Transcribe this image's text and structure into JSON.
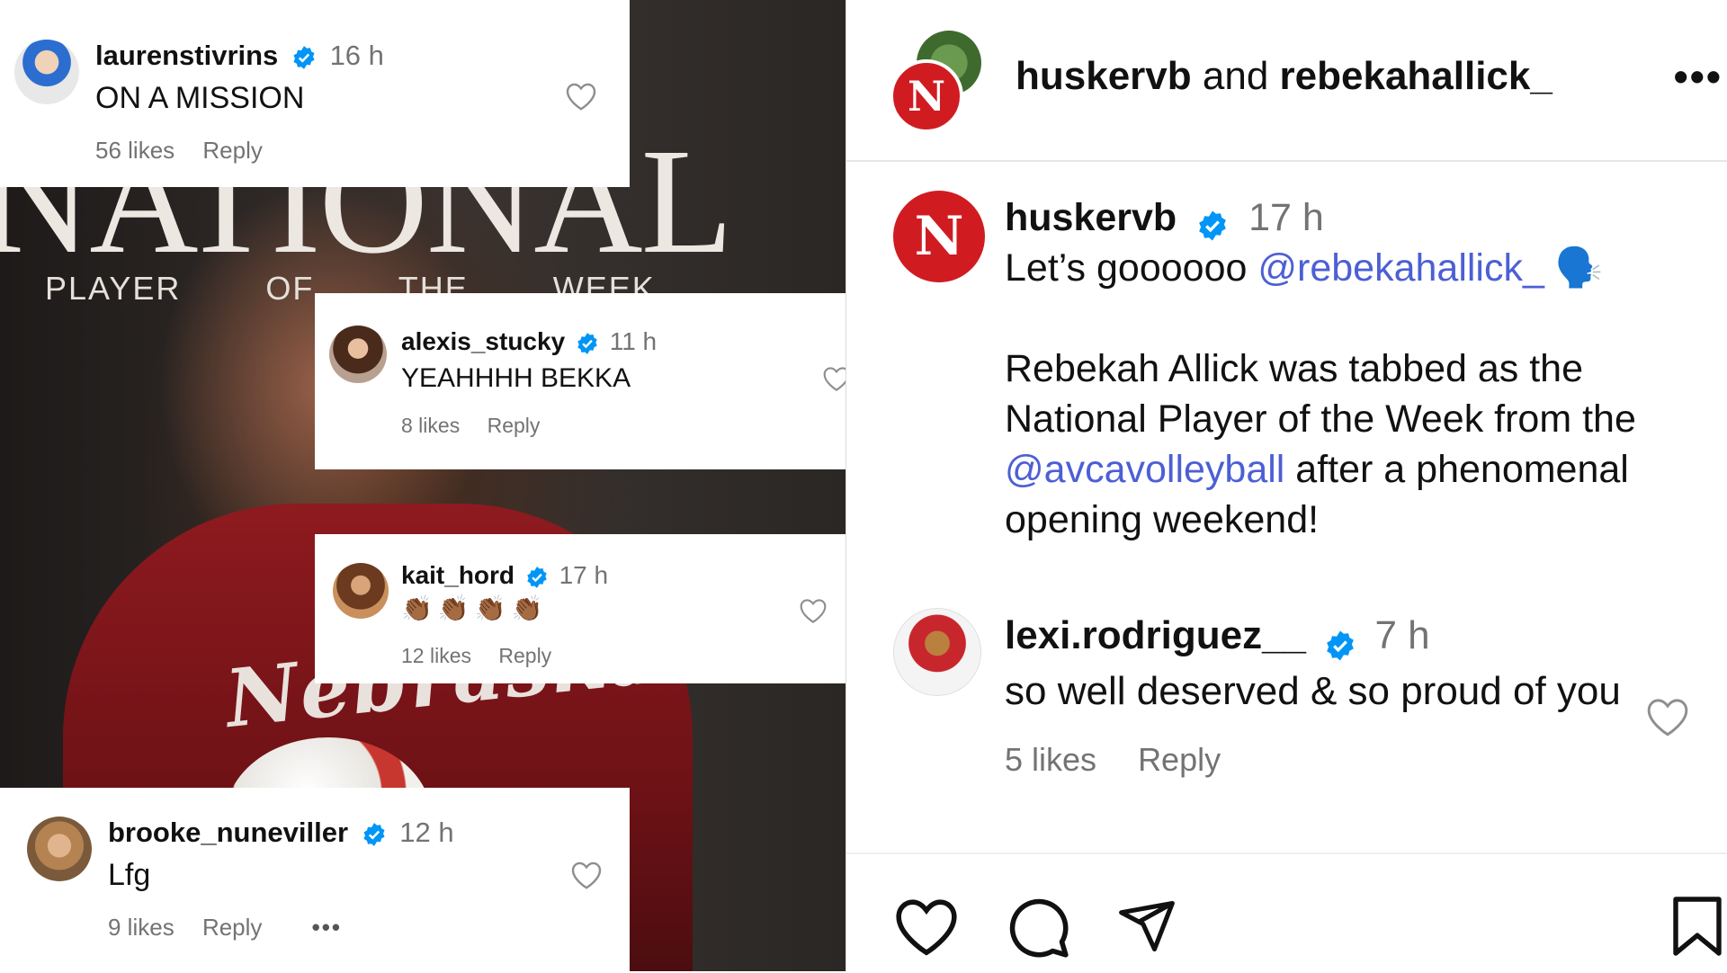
{
  "photo": {
    "headline": "NATIONAL",
    "subhead": "PLAYER OF THE WEEK",
    "jersey_text": "Nebraska"
  },
  "left_comments": [
    {
      "username": "laurenstivrins",
      "time": "16 h",
      "text": "ON A MISSION",
      "likes": "56 likes",
      "reply": "Reply"
    },
    {
      "username": "alexis_stucky",
      "time": "11 h",
      "text": "YEAHHHH BEKKA",
      "likes": "8 likes",
      "reply": "Reply"
    },
    {
      "username": "kait_hord",
      "time": "17 h",
      "text": "👏🏾👏🏾👏🏾👏🏾",
      "likes": "12 likes",
      "reply": "Reply"
    },
    {
      "username": "brooke_nuneviller",
      "time": "12 h",
      "text": "Lfg",
      "likes": "9 likes",
      "reply": "Reply",
      "more": "•••"
    }
  ],
  "header": {
    "account1": "huskervb",
    "and": "and",
    "account2": "rebekahallick_",
    "more": "•••",
    "logo_letter": "N"
  },
  "post": {
    "username": "huskervb",
    "time": "17 h",
    "line1_text": "Let’s goooooo ",
    "line1_mention": "@rebekahallick_",
    "line1_emoji": "🗣️",
    "body1": "Rebekah Allick was tabbed as the National Player of the Week from the ",
    "body_mention": "@avcavolleyball",
    "body2": " after a phenomenal opening weekend!"
  },
  "reply_comment": {
    "username": "lexi.rodriguez__",
    "time": "7 h",
    "text": "so well deserved & so proud of you",
    "likes": "5 likes",
    "reply": "Reply"
  },
  "actions": [
    "like-icon",
    "comment-icon",
    "share-icon",
    "bookmark-icon"
  ],
  "colors": {
    "verified": "#0095f6",
    "link": "#4c5fd5",
    "nebraska_red": "#d01c21",
    "muted": "#737373"
  }
}
